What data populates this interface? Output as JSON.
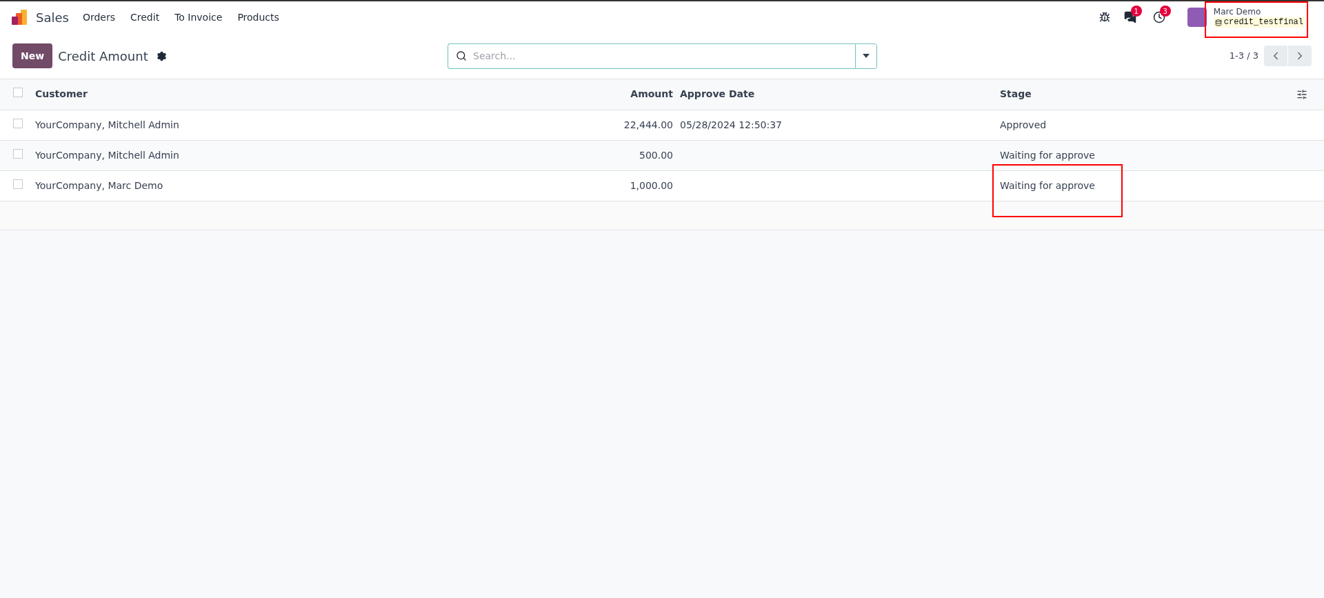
{
  "navbar": {
    "app": "Sales",
    "menu": [
      "Orders",
      "Credit",
      "To Invoice",
      "Products"
    ],
    "messages_badge": "1",
    "activities_badge": "3",
    "user": {
      "name": "Marc Demo",
      "database": "credit_testfinal"
    }
  },
  "control_panel": {
    "new_button": "New",
    "title": "Credit Amount",
    "search": {
      "placeholder": "Search..."
    },
    "pager": "1-3 / 3"
  },
  "table": {
    "select_all_checked": false,
    "columns": [
      "Customer",
      "Amount",
      "Approve Date",
      "Stage"
    ],
    "rows": [
      {
        "customer": "YourCompany, Mitchell Admin",
        "amount": "22,444.00",
        "approve_date": "05/28/2024 12:50:37",
        "stage": "Approved",
        "checked": false
      },
      {
        "customer": "YourCompany, Mitchell Admin",
        "amount": "500.00",
        "approve_date": "",
        "stage": "Waiting for approve",
        "checked": false
      },
      {
        "customer": "YourCompany, Marc Demo",
        "amount": "1,000.00",
        "approve_date": "",
        "stage": "Waiting for approve",
        "checked": false
      }
    ]
  }
}
